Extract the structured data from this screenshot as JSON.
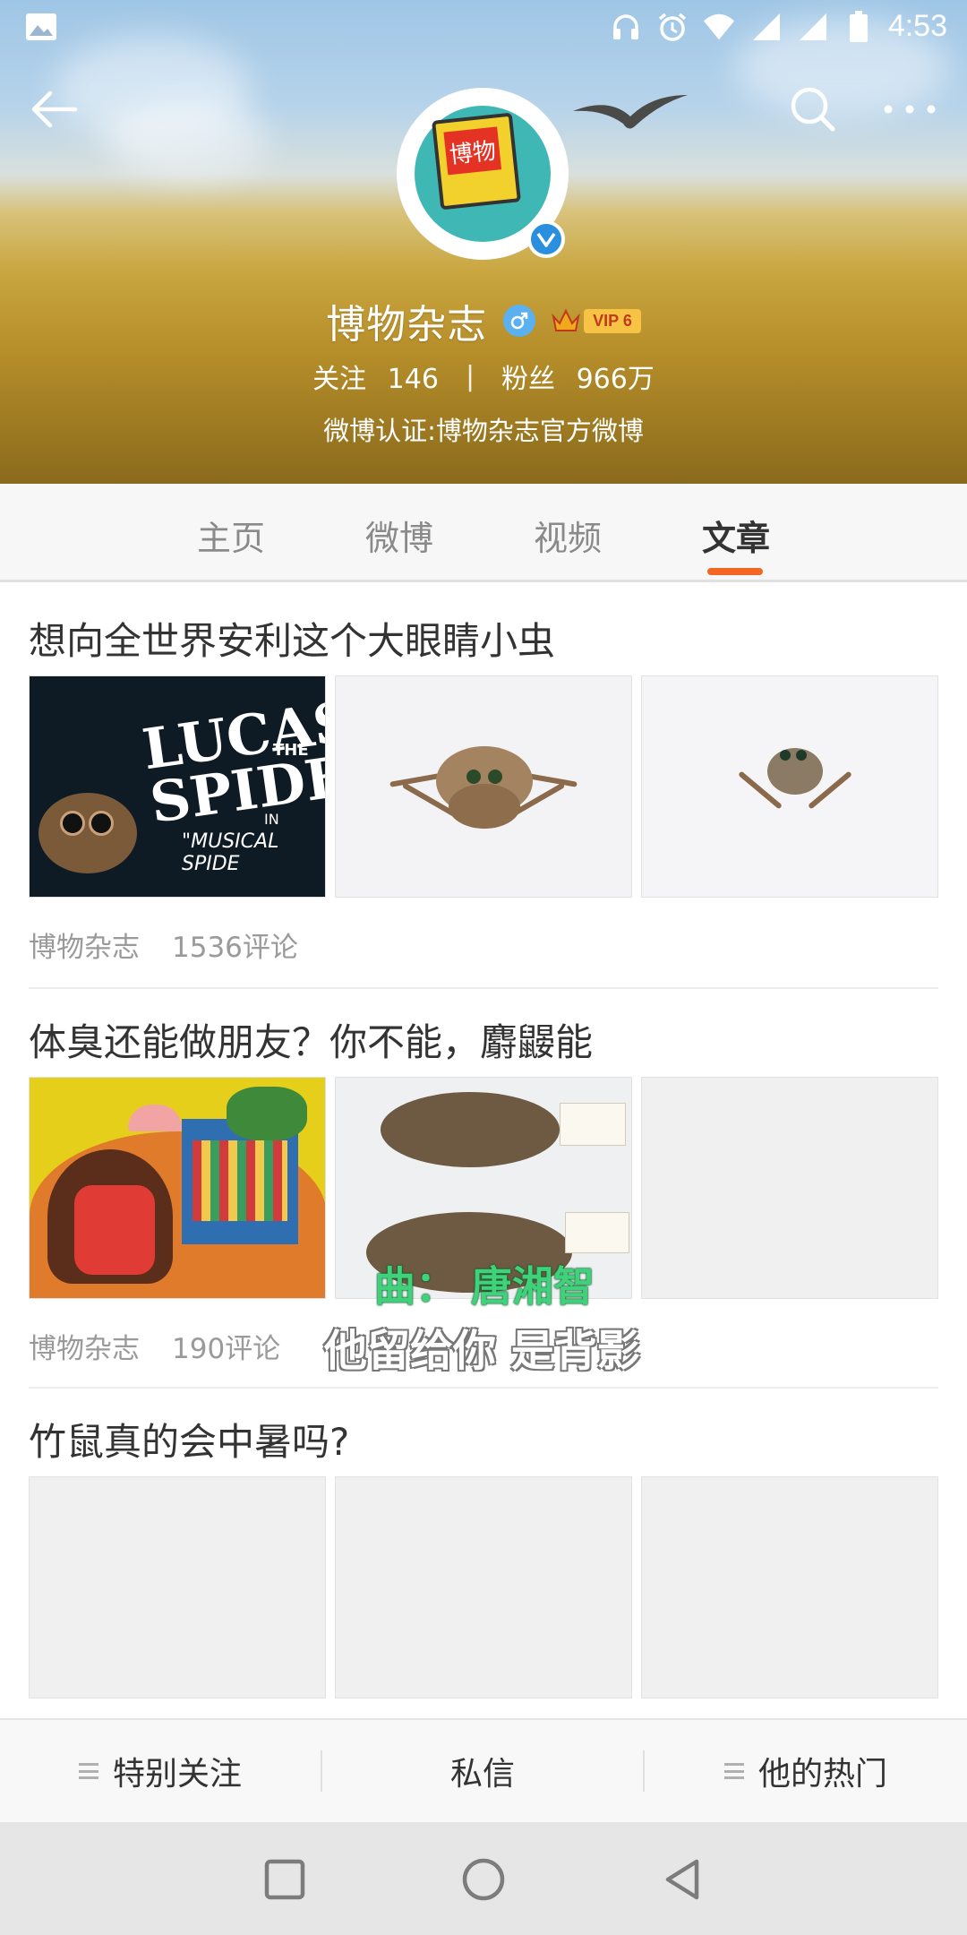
{
  "status_bar": {
    "time": "4:53",
    "icons": [
      "image-icon",
      "headphones-icon",
      "alarm-icon",
      "wifi-icon",
      "signal-icon",
      "signal-icon",
      "battery-icon"
    ]
  },
  "profile": {
    "name": "博物杂志",
    "avatar_text": "博物",
    "vip_label": "VIP 6",
    "following_label": "关注",
    "following_count": "146",
    "separator": "|",
    "followers_label": "粉丝",
    "followers_count": "966万",
    "verification": "微博认证:博物杂志官方微博"
  },
  "tabs": [
    {
      "label": "主页",
      "active": false
    },
    {
      "label": "微博",
      "active": false
    },
    {
      "label": "视频",
      "active": false
    },
    {
      "label": "文章",
      "active": true
    }
  ],
  "articles": [
    {
      "title": "想向全世界安利这个大眼睛小虫",
      "author": "博物杂志",
      "comments": "1536评论",
      "image_texts": {
        "lucas_line1": "LUCAS",
        "lucas_the": "THE",
        "lucas_line2": "SPIDE",
        "in": "IN",
        "musical": "\"MUSICAL SPIDE"
      }
    },
    {
      "title": "体臭还能做朋友？你不能，麝鼹能",
      "author": "博物杂志",
      "comments": "190评论"
    },
    {
      "title": "竹鼠真的会中暑吗?"
    }
  ],
  "overlay": {
    "line1": "曲：  唐湘智",
    "line2": "他留给你 是背影"
  },
  "bottom_bar": {
    "special_follow": "特别关注",
    "message": "私信",
    "his_hot": "他的热门"
  },
  "colors": {
    "accent": "#f26722",
    "verified_blue": "#2b8fe0",
    "gender_blue": "#5bb0ef",
    "vip_gold": "#f6c344"
  }
}
